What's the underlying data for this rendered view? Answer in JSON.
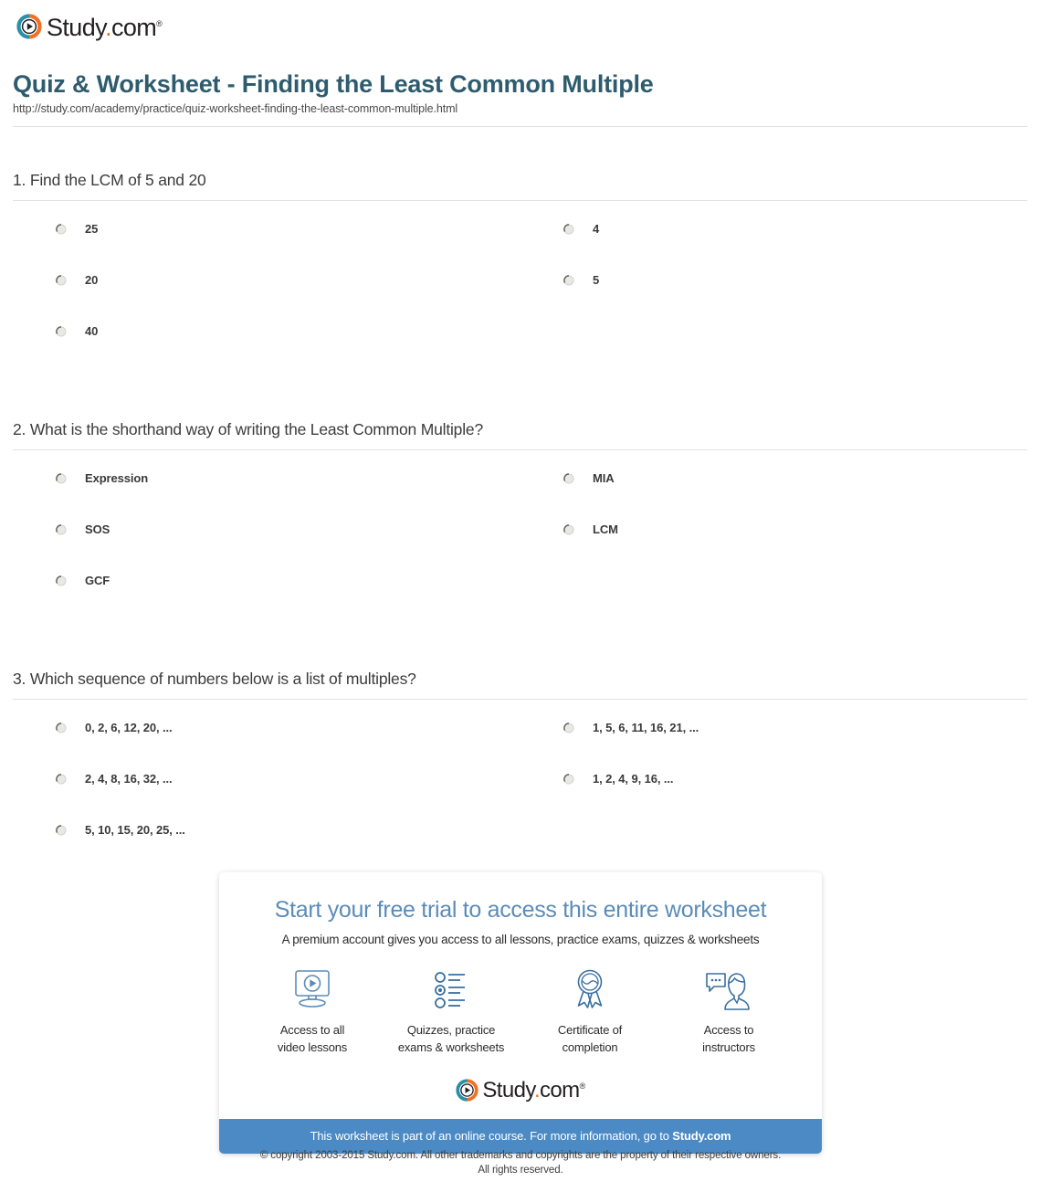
{
  "brand": {
    "name_main": "Study",
    "name_dot": ".",
    "name_tld": "com",
    "trademark": "®",
    "icon": "play-circle-icon",
    "colors": {
      "orange": "#f37021",
      "teal": "#2c8fa8",
      "dark": "#231f20"
    }
  },
  "header": {
    "title": "Quiz & Worksheet - Finding the Least Common Multiple",
    "url": "http://study.com/academy/practice/quiz-worksheet-finding-the-least-common-multiple.html",
    "title_color": "#2e5c6e"
  },
  "questions": [
    {
      "text": "1. Find the LCM of 5 and 20",
      "left_options": [
        "25",
        "20",
        "40"
      ],
      "right_options": [
        "4",
        "5"
      ]
    },
    {
      "text": "2. What is the shorthand way of writing the Least Common Multiple?",
      "left_options": [
        "Expression",
        "SOS",
        "GCF"
      ],
      "right_options": [
        "MIA",
        "LCM"
      ]
    },
    {
      "text": "3. Which sequence of numbers below is a list of multiples?",
      "left_options": [
        "0, 2, 6, 12, 20, ...",
        "2, 4, 8, 16, 32, ...",
        "5, 10, 15, 20, 25, ..."
      ],
      "right_options": [
        "1, 5, 6, 11, 16, 21, ...",
        "1, 2, 4, 9, 16, ..."
      ]
    }
  ],
  "promo": {
    "title": "Start your free trial to access this entire worksheet",
    "subtitle": "A premium account gives you access to all lessons, practice exams, quizzes & worksheets",
    "title_color": "#5b8cb8",
    "features": [
      {
        "icon": "monitor-play-icon",
        "label": "Access to all\nvideo lessons",
        "line1": "Access to all",
        "line2": "video lessons"
      },
      {
        "icon": "quiz-list-icon",
        "label": "Quizzes, practice\nexams & worksheets",
        "line1": "Quizzes, practice",
        "line2": "exams & worksheets"
      },
      {
        "icon": "award-ribbon-icon",
        "label": "Certificate of\ncompletion",
        "line1": "Certificate of",
        "line2": "completion"
      },
      {
        "icon": "instructor-chat-icon",
        "label": "Access to\ninstructors",
        "line1": "Access to",
        "line2": "instructors"
      }
    ],
    "bar_text_prefix": "This worksheet is part of an online course. For more information, go to ",
    "bar_link": "Study.com",
    "bar_color": "#4b8ac4"
  },
  "footer": {
    "copyright_line1": "© copyright 2003-2015 Study.com. All other trademarks and copyrights are the property of their respective owners.",
    "copyright_line2": "All rights reserved."
  }
}
